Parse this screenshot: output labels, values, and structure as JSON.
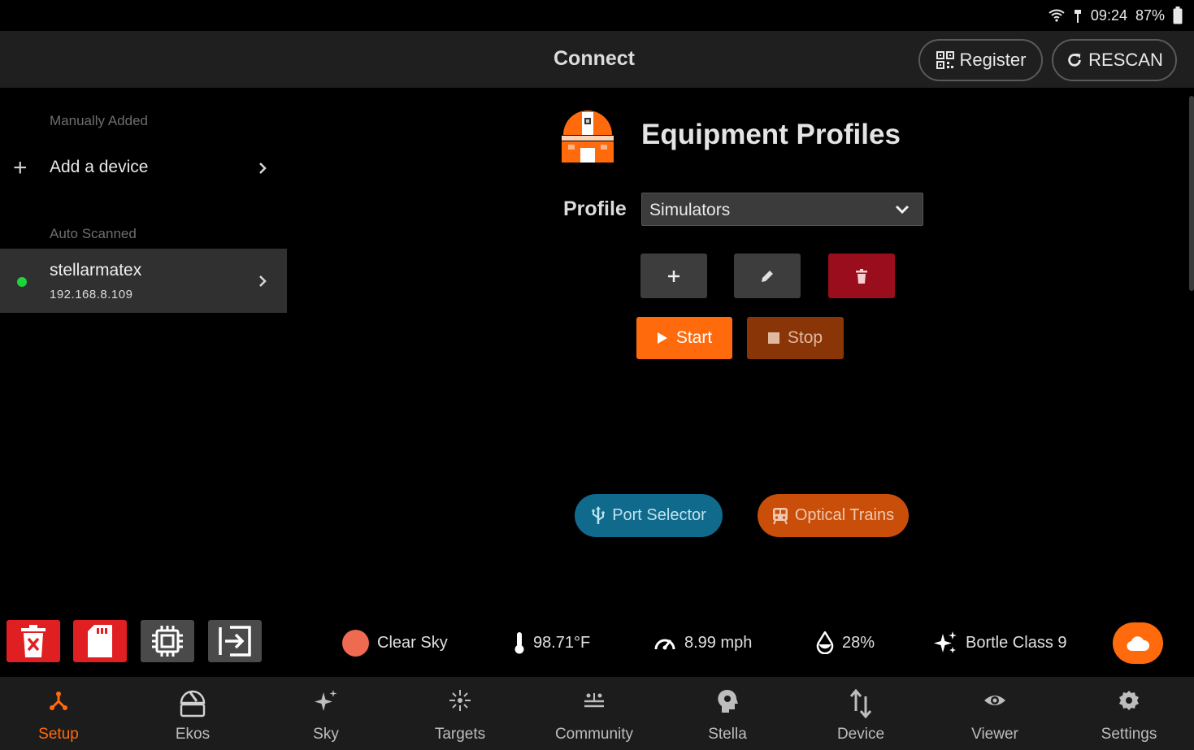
{
  "status_bar": {
    "time": "09:24",
    "battery": "87%"
  },
  "header": {
    "title": "Connect",
    "register_label": "Register",
    "rescan_label": "RESCAN"
  },
  "sidebar": {
    "manual_section": "Manually Added",
    "add_device_label": "Add a device",
    "auto_section": "Auto Scanned",
    "device": {
      "name": "stellarmatex",
      "ip": "192.168.8.109",
      "status_color": "#1fd43b"
    }
  },
  "main": {
    "title": "Equipment Profiles",
    "profile_label": "Profile",
    "profile_value": "Simulators",
    "start_label": "Start",
    "stop_label": "Stop",
    "port_selector_label": "Port Selector",
    "optical_trains_label": "Optical Trains"
  },
  "weather": {
    "sky": "Clear Sky",
    "temperature": "98.71°F",
    "wind": "8.99 mph",
    "humidity": "28%",
    "bortle": "Bortle Class 9"
  },
  "nav": {
    "items": [
      {
        "label": "Setup",
        "icon": "setup-icon",
        "active": true
      },
      {
        "label": "Ekos",
        "icon": "ekos-icon"
      },
      {
        "label": "Sky",
        "icon": "sky-icon"
      },
      {
        "label": "Targets",
        "icon": "targets-icon"
      },
      {
        "label": "Community",
        "icon": "community-icon"
      },
      {
        "label": "Stella",
        "icon": "stella-icon"
      },
      {
        "label": "Device",
        "icon": "device-icon"
      },
      {
        "label": "Viewer",
        "icon": "viewer-icon"
      },
      {
        "label": "Settings",
        "icon": "settings-icon"
      }
    ]
  },
  "colors": {
    "accent": "#ff6a0d",
    "danger": "#9a0d1d",
    "port": "#0f6a8c"
  }
}
